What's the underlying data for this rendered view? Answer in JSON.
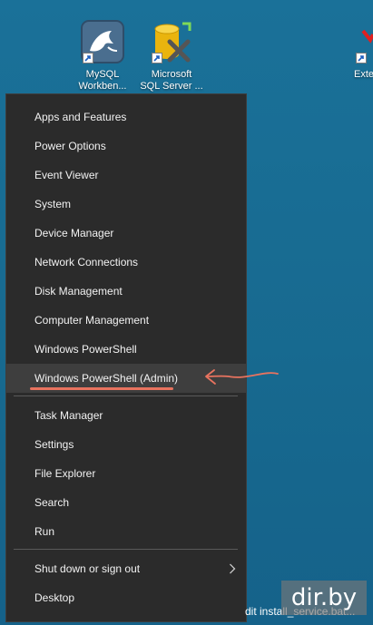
{
  "desktop": {
    "icons": [
      {
        "line1": "MySQL",
        "line2": "Workben...",
        "icon": "mysql-dolphin-icon"
      },
      {
        "line1": "Microsoft",
        "line2": "SQL Server ...",
        "icon": "sql-server-icon"
      },
      {
        "line1": "",
        "line2": "Exte",
        "icon": "extension-icon"
      }
    ]
  },
  "menu": {
    "items": [
      "Apps and Features",
      "Power Options",
      "Event Viewer",
      "System",
      "Device Manager",
      "Network Connections",
      "Disk Management",
      "Computer Management",
      "Windows PowerShell",
      "Windows PowerShell (Admin)",
      "Task Manager",
      "Settings",
      "File Explorer",
      "Search",
      "Run",
      "Shut down or sign out",
      "Desktop"
    ],
    "highlighted": "Windows PowerShell (Admin)",
    "submenu_icon": "chevron-right-icon"
  },
  "taskbar": {
    "text": "dit install_service.bat..."
  },
  "watermark": {
    "text": "dir.by"
  },
  "colors": {
    "menu_bg": "#2b2b2b",
    "highlight_bg": "#3e3e3e",
    "annotation": "#e8735f",
    "desktop_bg": "#1b6f95"
  }
}
